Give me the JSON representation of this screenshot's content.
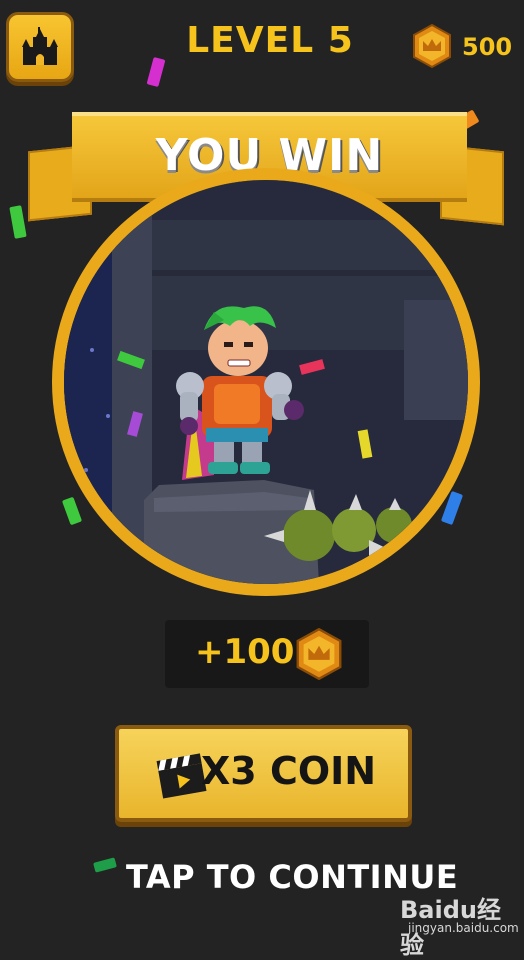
{
  "header": {
    "home_icon": "castle-icon",
    "level_label": "LEVEL 5",
    "coin_icon": "crown-coin-icon",
    "coin_count": "500"
  },
  "banner": {
    "title": "YOU WIN"
  },
  "scene": {
    "description_icon": "hero-knight-green-hair",
    "hazard_icon": "spiked-ball"
  },
  "reward": {
    "amount": "+100",
    "icon": "crown-coin-icon"
  },
  "multiplier_button": {
    "icon": "video-clapper-icon",
    "label": "X3 COIN"
  },
  "continue_text": "TAP TO CONTINUE",
  "watermark": {
    "logo": "Baidu经验",
    "url": "jingyan.baidu.com"
  },
  "colors": {
    "background": "#232323",
    "gold": "#f6c31d",
    "button": "#e9b52c",
    "frame": "#e9a91b"
  }
}
